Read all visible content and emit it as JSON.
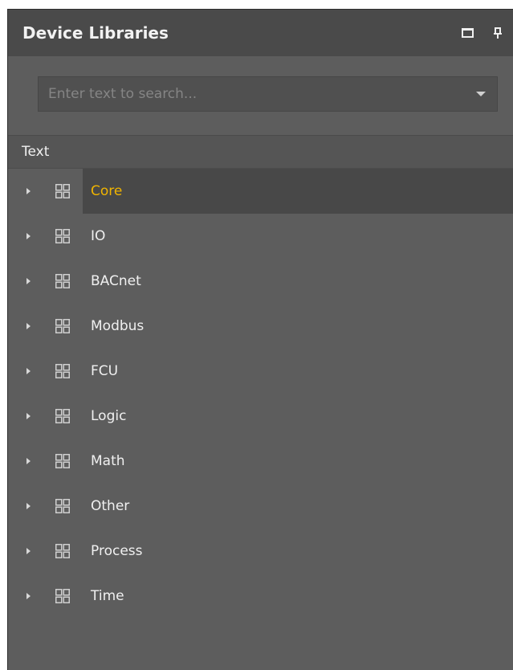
{
  "panel": {
    "title": "Device Libraries",
    "restore_icon": "restore-window-icon",
    "pin_icon": "pin-icon"
  },
  "search": {
    "placeholder": "Enter text to search...",
    "value": "",
    "dropdown_icon": "chevron-down-icon"
  },
  "column_header": "Text",
  "colors": {
    "panel_bg": "#5d5d5d",
    "titlebar_bg": "#4a4a4a",
    "selected_text": "#f0b400",
    "text": "#f0f0f0"
  },
  "libraries": [
    {
      "label": "Core",
      "selected": true
    },
    {
      "label": "IO"
    },
    {
      "label": "BACnet"
    },
    {
      "label": "Modbus"
    },
    {
      "label": "FCU"
    },
    {
      "label": "Logic"
    },
    {
      "label": "Math"
    },
    {
      "label": "Other"
    },
    {
      "label": "Process"
    },
    {
      "label": "Time"
    }
  ]
}
